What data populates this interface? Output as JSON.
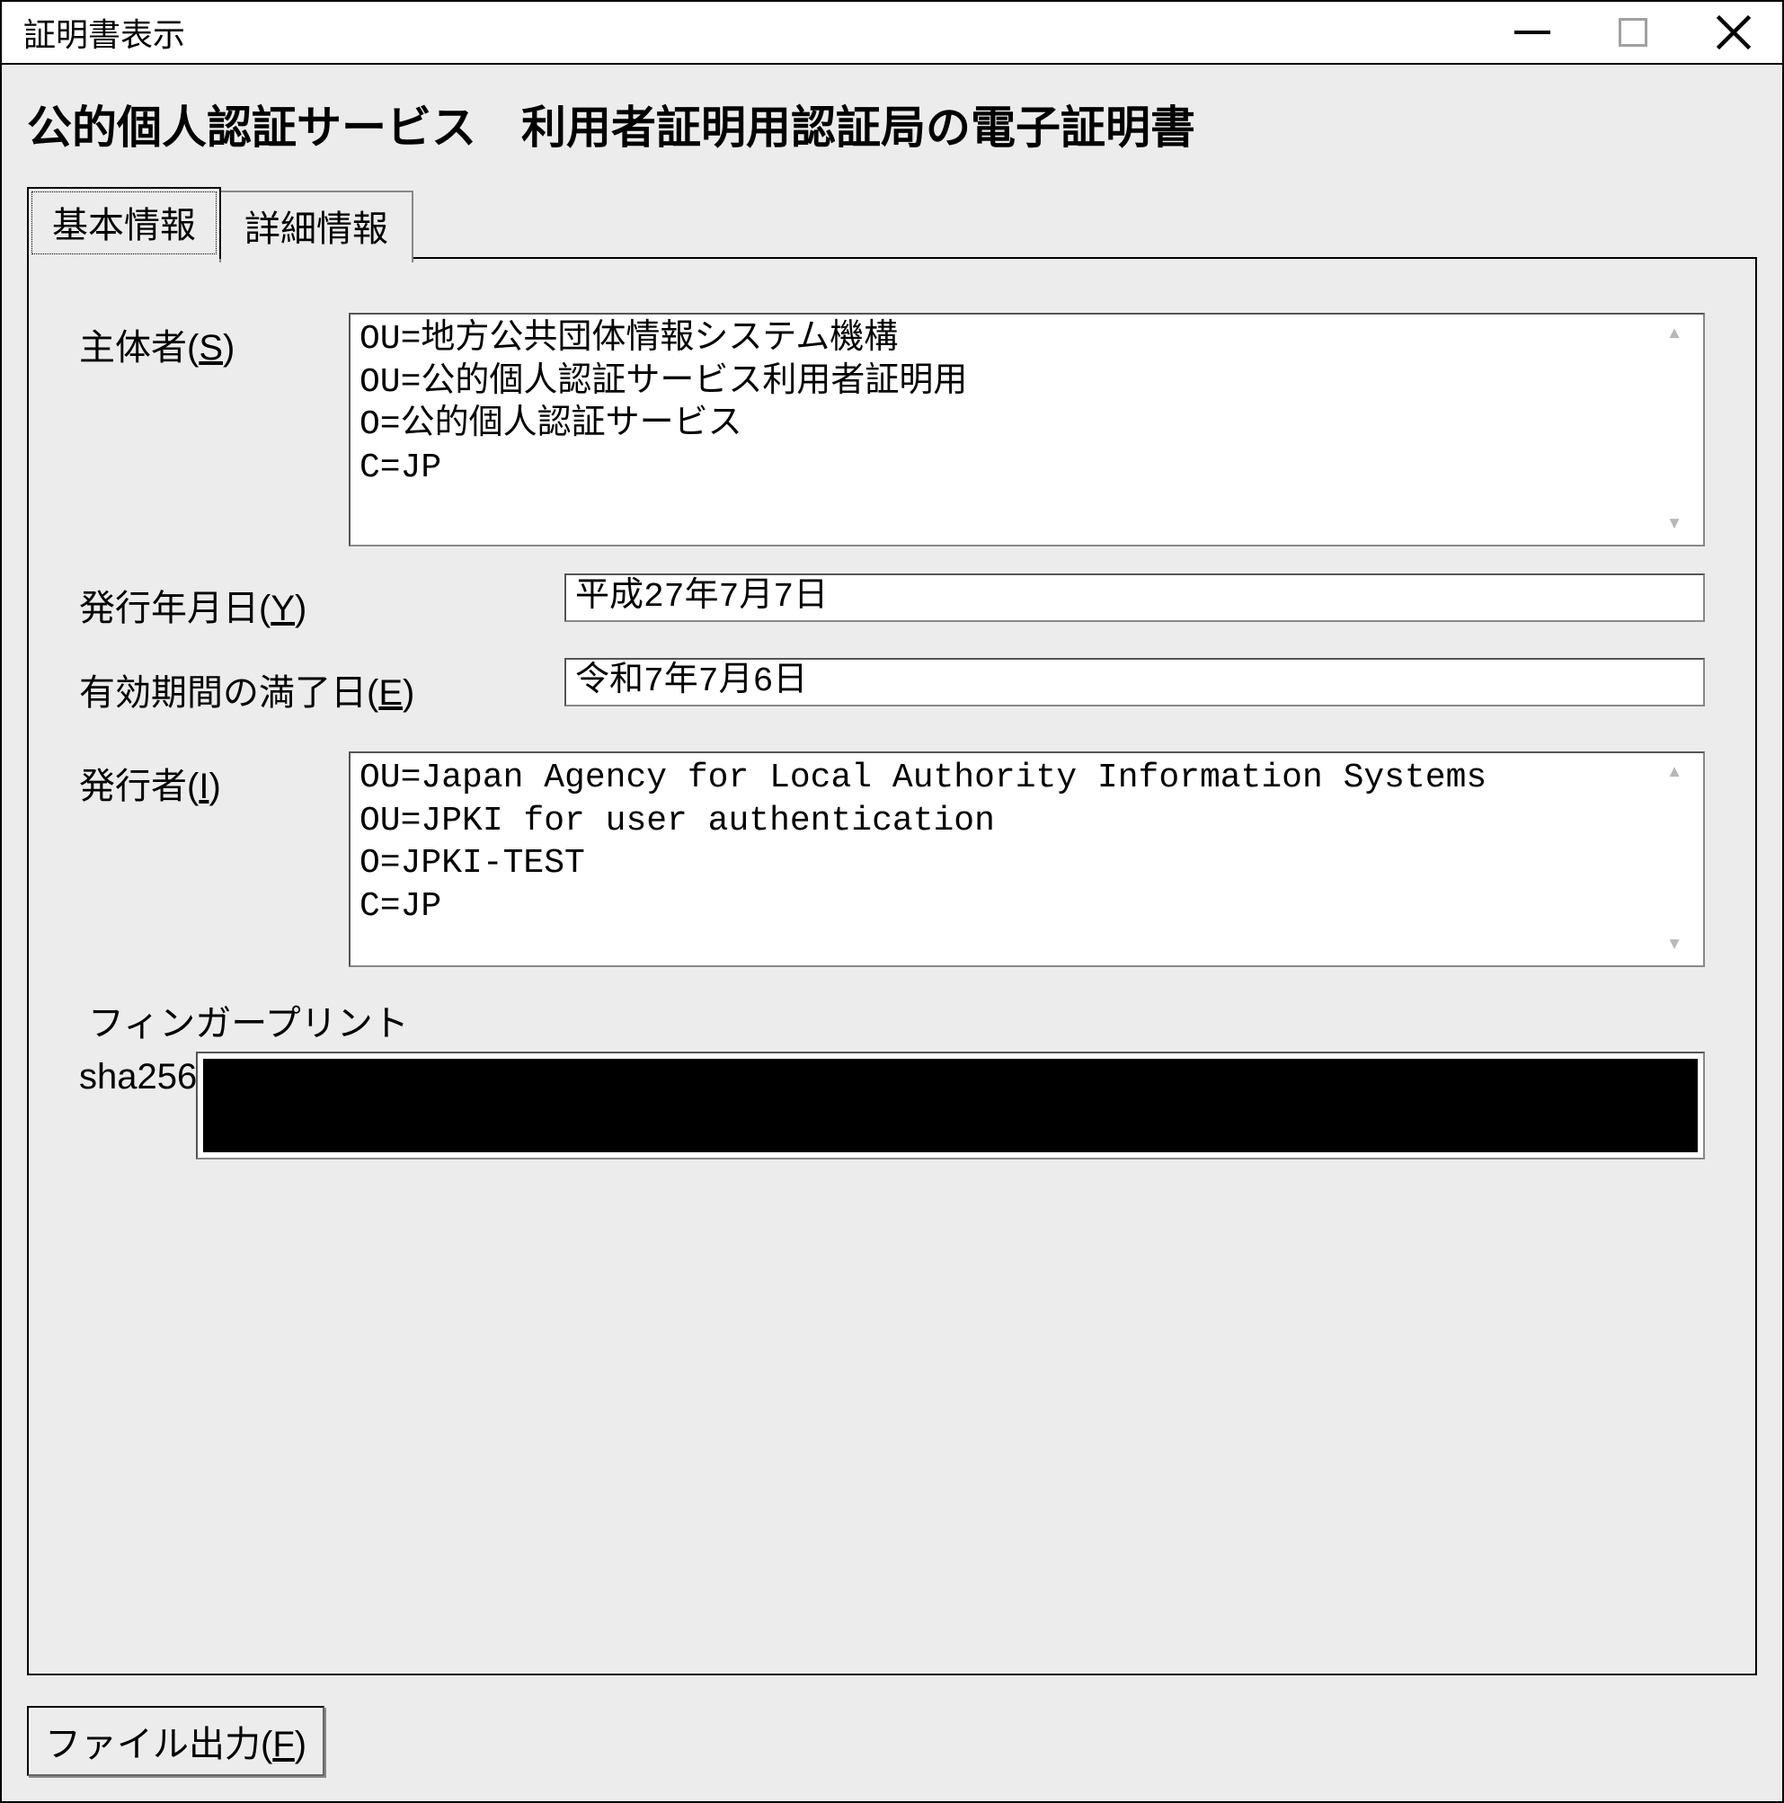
{
  "window": {
    "title": "証明書表示"
  },
  "header": {
    "page_title": "公的個人認証サービス　利用者証明用認証局の電子証明書"
  },
  "tabs": {
    "basic": "基本情報",
    "detail": "詳細情報"
  },
  "labels": {
    "subject_pre": "主体者(",
    "subject_key": "S",
    "subject_post": ")",
    "issue_date_pre": "発行年月日(",
    "issue_date_key": "Y",
    "issue_date_post": ")",
    "expire_date_pre": "有効期間の満了日(",
    "expire_date_key": "E",
    "expire_date_post": ")",
    "issuer_pre": "発行者(",
    "issuer_key": "I",
    "issuer_post": ")",
    "fingerprint": "フィンガープリント",
    "fingerprint_alg": "sha256"
  },
  "values": {
    "subject": "OU=地方公共団体情報システム機構\nOU=公的個人認証サービス利用者証明用\nO=公的個人認証サービス\nC=JP",
    "issue_date": "平成27年7月7日",
    "expire_date": "令和7年7月6日",
    "issuer": "OU=Japan Agency for Local Authority Information Systems\nOU=JPKI for user authentication\nO=JPKI-TEST\nC=JP"
  },
  "buttons": {
    "file_output_pre": "ファイル出力(",
    "file_output_key": "F",
    "file_output_post": ")"
  }
}
